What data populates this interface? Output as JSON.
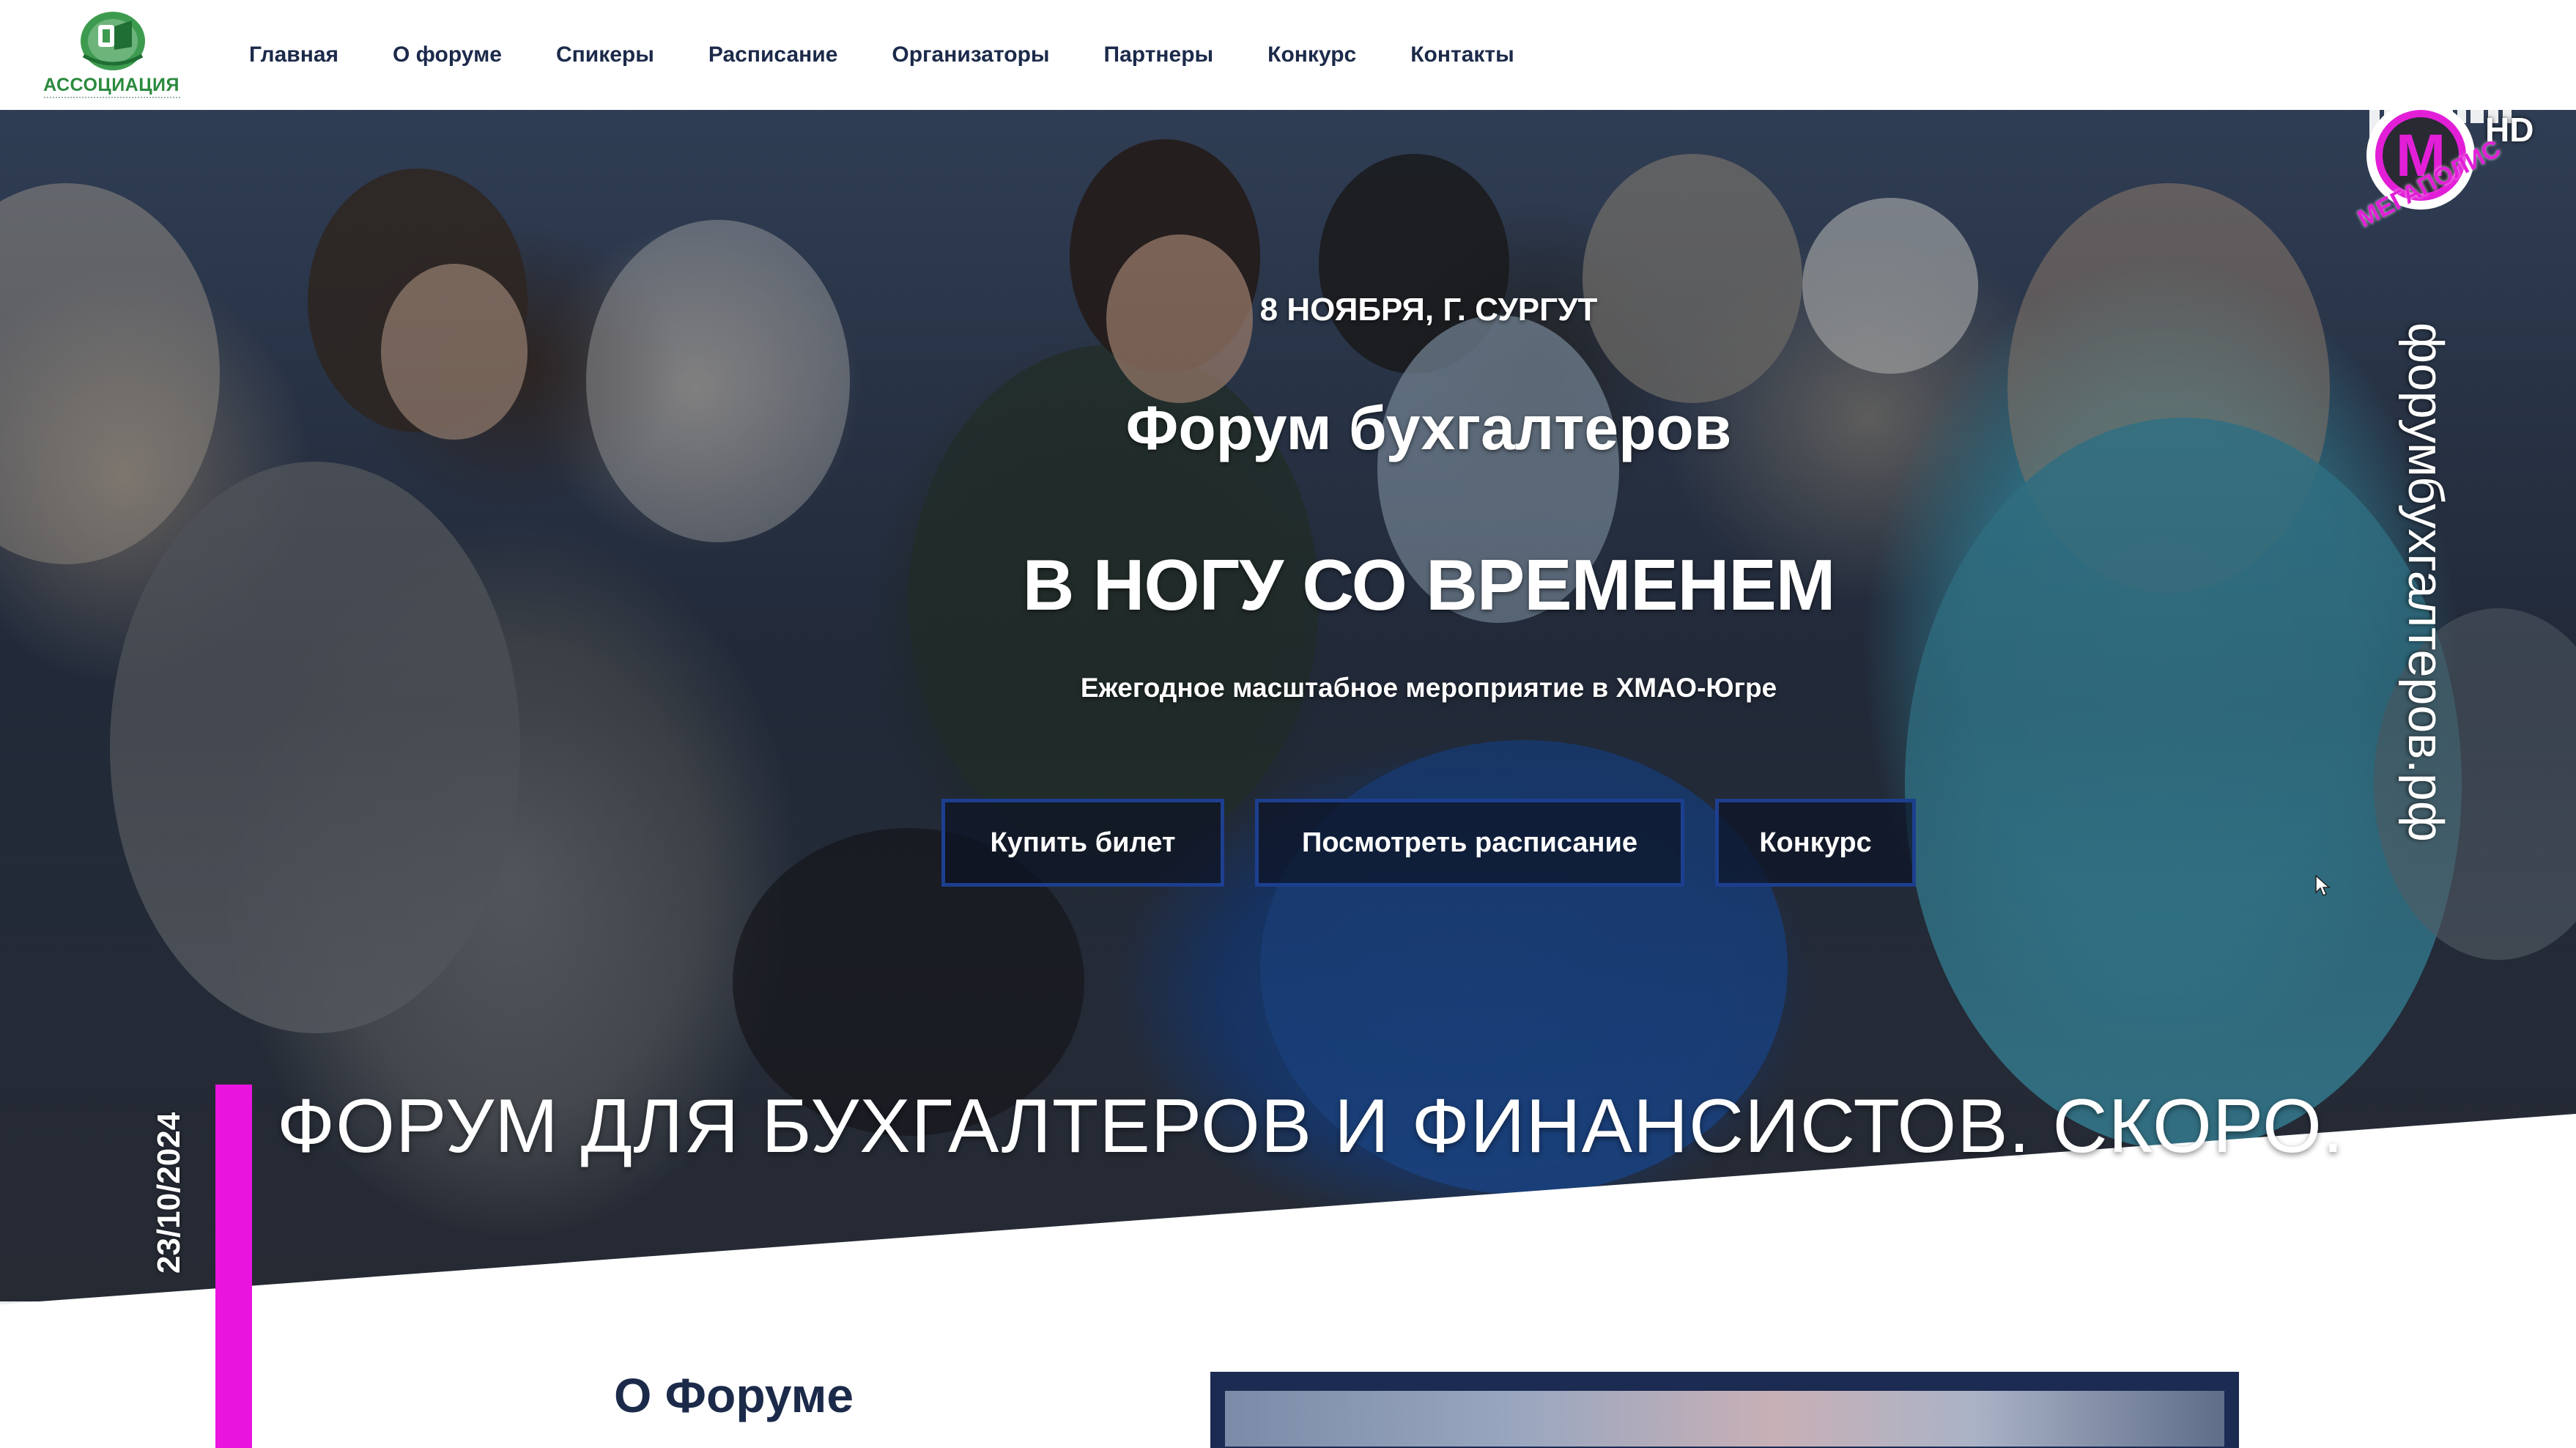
{
  "nav": {
    "logo_text": "АССОЦИАЦИЯ",
    "items": [
      {
        "label": "Главная"
      },
      {
        "label": "О форуме"
      },
      {
        "label": "Спикеры"
      },
      {
        "label": "Расписание"
      },
      {
        "label": "Организаторы"
      },
      {
        "label": "Партнеры"
      },
      {
        "label": "Конкурс"
      },
      {
        "label": "Контакты"
      }
    ]
  },
  "hero": {
    "date_place": "8 НОЯБРЯ, Г. СУРГУТ",
    "title": "Форум бухгалтеров",
    "slogan": "В НОГУ СО ВРЕМЕНЕМ",
    "subtitle": "Ежегодное масштабное мероприятие в ХМАО-Югре",
    "buttons": {
      "buy": "Купить билет",
      "schedule": "Посмотреть расписание",
      "contest": "Конкурс"
    }
  },
  "overlay": {
    "channel_logo_letter": "M",
    "channel_hd": "HD",
    "channel_name": "МЕГАПОЛИС",
    "site_caption": "форумбухгалтеров.рф",
    "ticker_date": "23/10/2024",
    "ticker_headline": "ФОРУМ ДЛЯ БУХГАЛТЕРОВ И ФИНАНСИСТОВ. СКОРО."
  },
  "about": {
    "title": "О Форуме"
  },
  "colors": {
    "nav_text": "#1c2a4a",
    "button_border": "#1d3f8f",
    "ticker_accent": "#ea14df",
    "logo_green": "#2b8a3e"
  }
}
